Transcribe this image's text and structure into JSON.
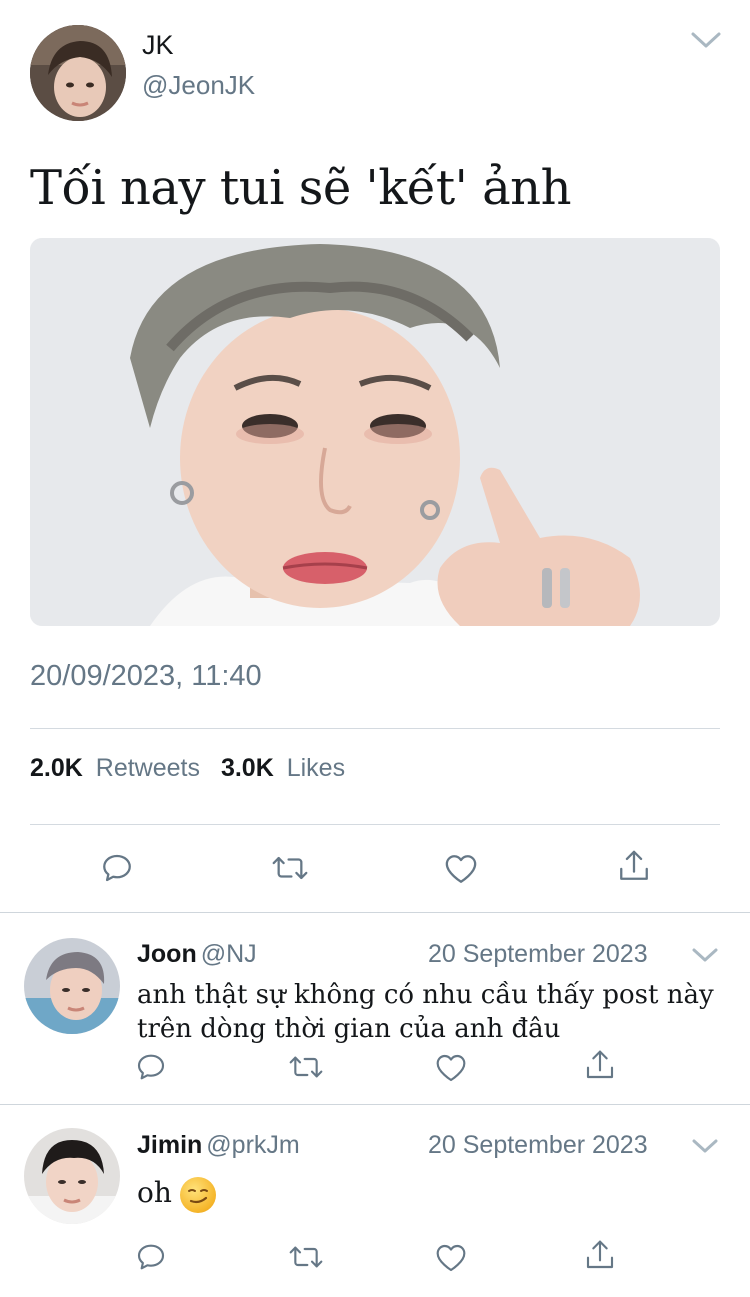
{
  "tweet": {
    "author_name": "JK",
    "author_handle": "@JeonJK",
    "text": "Tối nay tui sẽ 'kết' ảnh",
    "timestamp": "20/09/2023, 11:40",
    "retweet_count": "2.0K",
    "retweet_label": "Retweets",
    "like_count": "3.0K",
    "like_label": "Likes"
  },
  "replies": [
    {
      "name": "Joon",
      "handle": "@NJ",
      "date": "20 September 2023",
      "text_line1": "anh thật sự không có nhu cầu thấy post này",
      "text_line2": "trên dòng thời gian của anh đâu"
    },
    {
      "name": "Jimin",
      "handle": "@prkJm",
      "date": "20 September 2023",
      "text": "oh",
      "emoji": "smirk-emoji"
    }
  ],
  "icons": {
    "reply": "reply-icon",
    "retweet": "retweet-icon",
    "like": "heart-icon",
    "share": "share-icon",
    "more": "chevron-down-icon"
  },
  "colors": {
    "text": "#14171a",
    "secondary": "#657786",
    "divider": "#d4dae0"
  }
}
